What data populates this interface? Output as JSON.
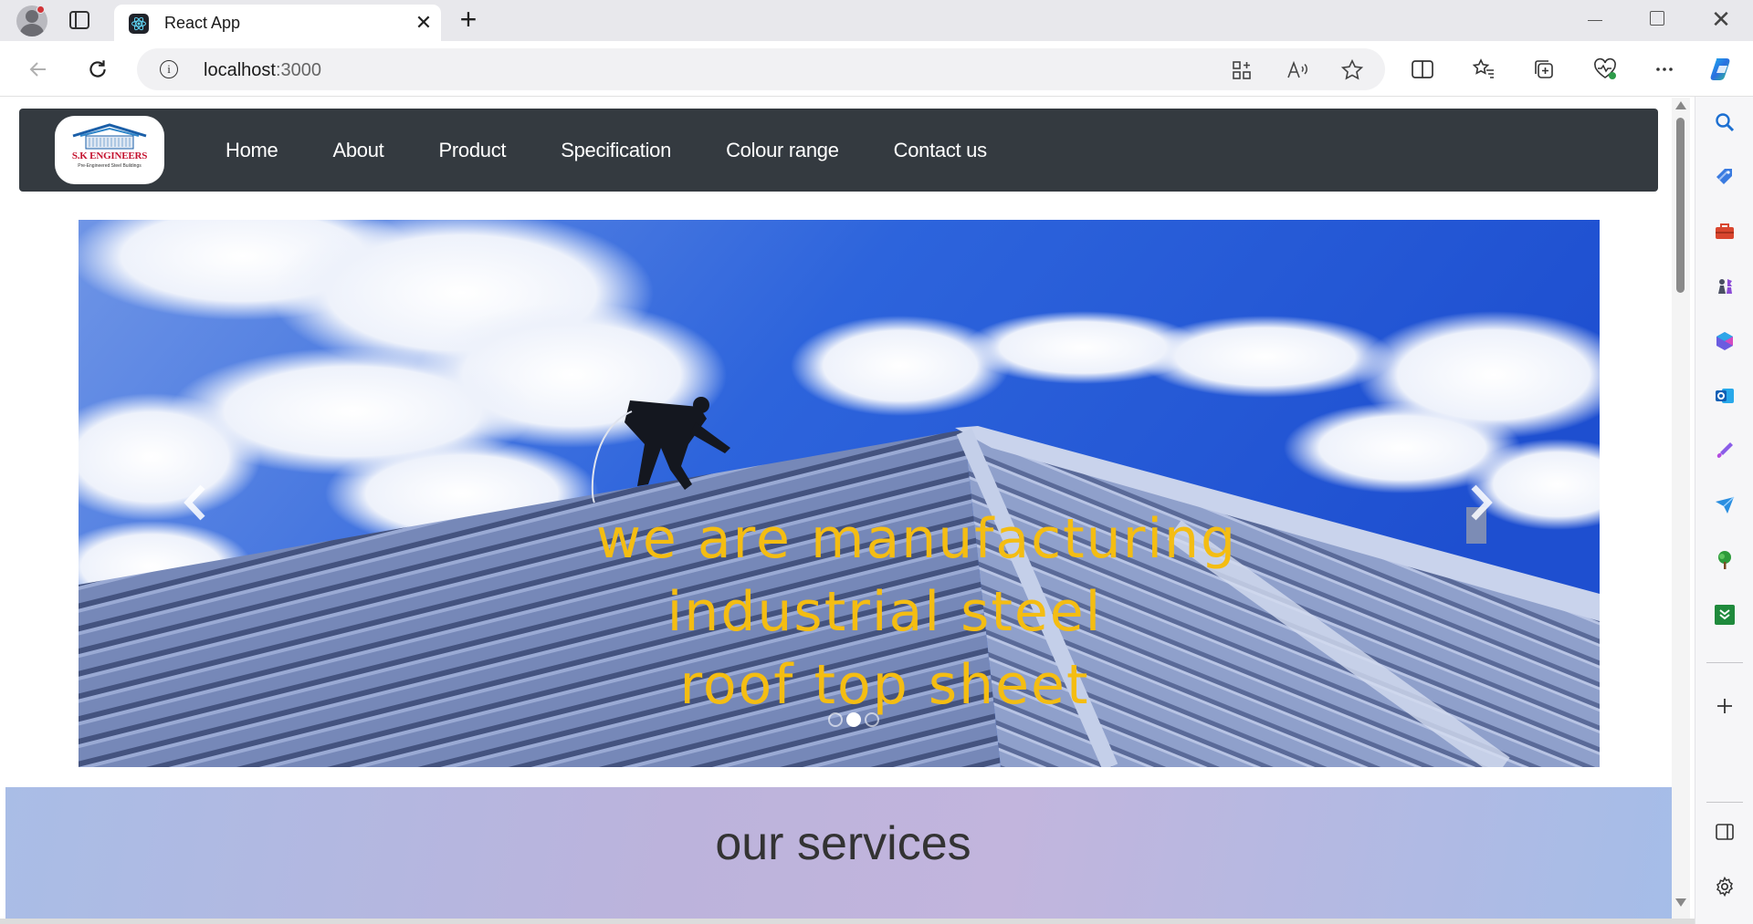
{
  "browser": {
    "tab_title": "React App",
    "address_host": "localhost",
    "address_port": ":3000"
  },
  "site": {
    "logo": {
      "name": "S.K ENGINEERS",
      "tagline": "Pre-Engineered Steel Buildings"
    },
    "nav": [
      {
        "label": "Home"
      },
      {
        "label": "About"
      },
      {
        "label": "Product"
      },
      {
        "label": "Specification"
      },
      {
        "label": "Colour range"
      },
      {
        "label": "Contact us"
      }
    ],
    "carousel": {
      "caption_lines": [
        "we are manufacturing",
        "industrial steel",
        "roof top sheet"
      ],
      "slide_count": 3,
      "active_slide": 2
    },
    "services_title": "our services"
  },
  "colors": {
    "navbar": "#343a40",
    "caption": "#f4bd12",
    "sky": "#2f63d6"
  }
}
